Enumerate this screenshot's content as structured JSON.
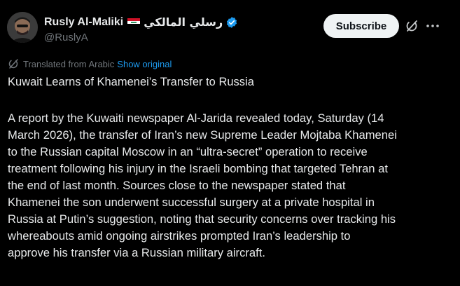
{
  "author": {
    "display_name": "Rusly Al-Maliki",
    "arabic_name": "رسلي المالكي",
    "handle": "@RuslyA",
    "flag": "iraq-flag",
    "verified": true
  },
  "actions": {
    "subscribe_label": "Subscribe",
    "grok_icon": "grok-icon",
    "more_icon": "more-dots-icon"
  },
  "translation": {
    "label": "Translated from Arabic",
    "show_original": "Show original"
  },
  "post": {
    "title": "Kuwait Learns of Khamenei’s Transfer to Russia",
    "lines": [
      "A report by the Kuwaiti newspaper Al-Jarida revealed today, Saturday (14",
      "March 2026), the transfer of Iran’s new Supreme Leader Mojtaba Khamenei",
      "to the Russian capital Moscow in an “ultra-secret” operation to receive",
      "treatment following his injury in the Israeli bombing that targeted Tehran at",
      "the end of last month. Sources close to the newspaper stated that",
      "Khamenei the son underwent successful surgery at a private hospital in",
      "Russia at Putin’s suggestion, noting that security concerns over tracking his",
      "whereabouts amid ongoing airstrikes prompted Iran’s leadership to",
      "approve his transfer via a Russian military aircraft."
    ]
  },
  "colors": {
    "background": "#000000",
    "text": "#e7e9ea",
    "muted": "#71767b",
    "link": "#1d9bf0",
    "verified": "#1d9bf0",
    "button_bg": "#eff3f4"
  }
}
